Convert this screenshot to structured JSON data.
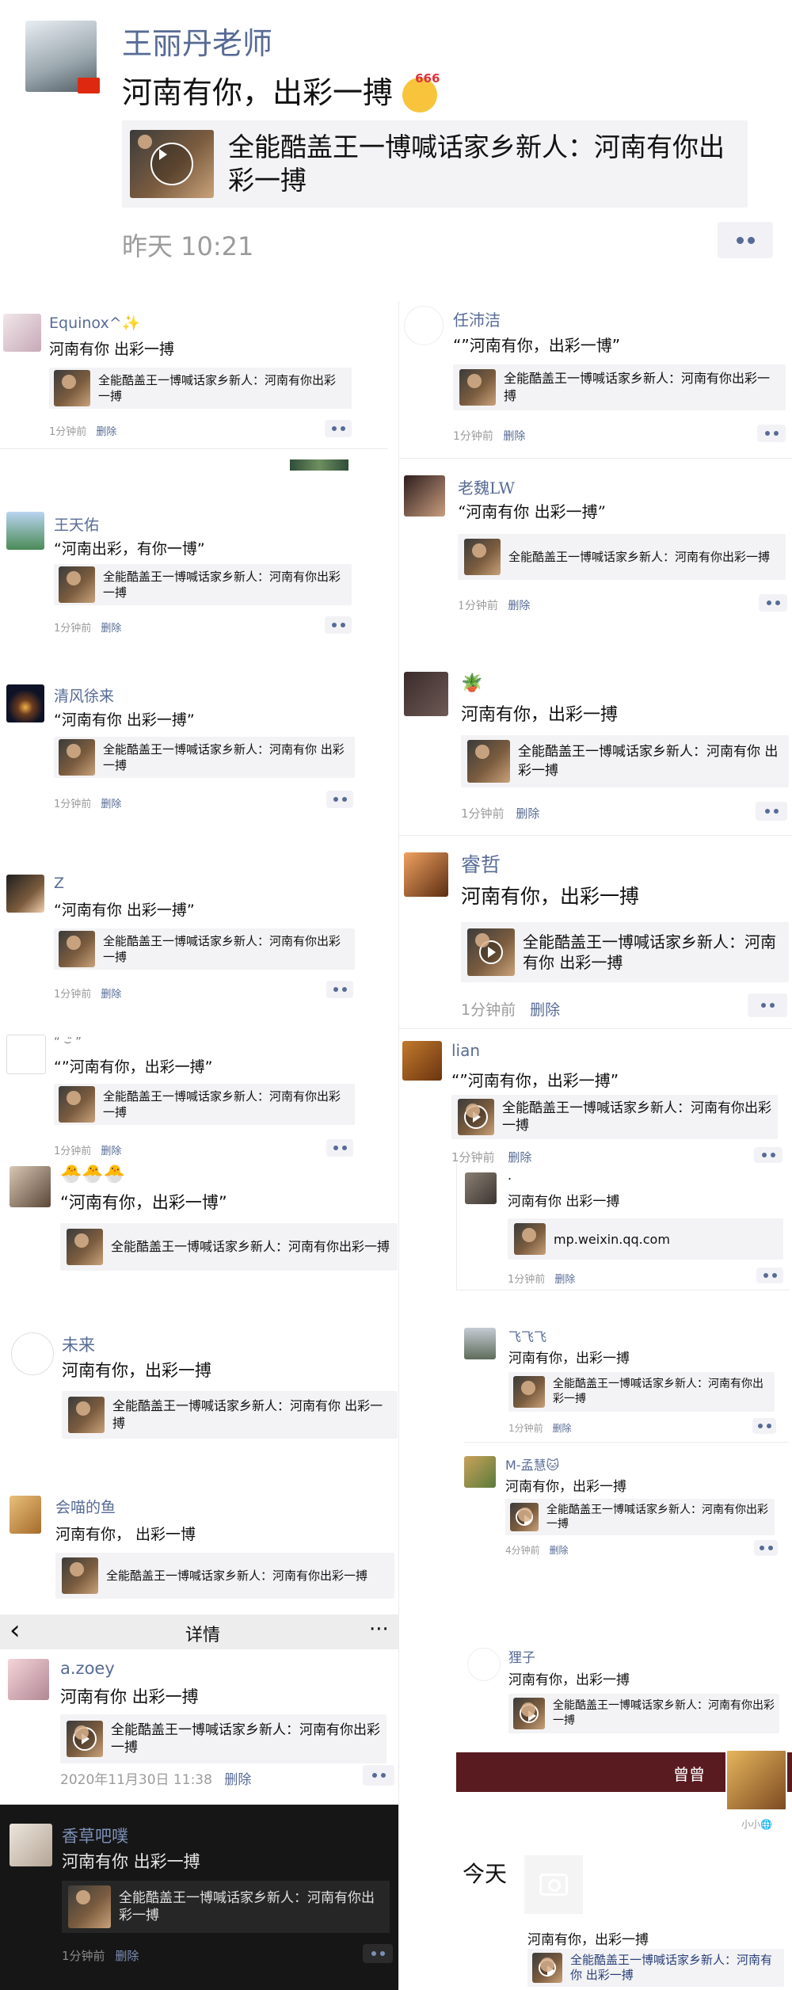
{
  "top": {
    "author": "王丽丹老师",
    "text": "河南有你，出彩一搏",
    "emoji_badge": "666",
    "link": "全能酷盖王一博喊话家乡新人：河南有你出彩一搏",
    "time": "昨天 10:21"
  },
  "left": [
    {
      "name": "Equinox^✨",
      "text": "河南有你 出彩一搏",
      "link": "全能酷盖王一博喊话家乡新人：河南有你出彩一搏",
      "time": "1分钟前",
      "del": "删除"
    },
    {
      "name": "王天佑",
      "text": "“河南出彩，有你一博”",
      "link": "全能酷盖王一博喊话家乡新人：河南有你出彩一搏",
      "time": "1分钟前",
      "del": "删除"
    },
    {
      "name": "清风徐来",
      "text": "“河南有你 出彩一搏”",
      "link": "全能酷盖王一博喊话家乡新人：河南有你 出彩一搏",
      "time": "1分钟前",
      "del": "删除"
    },
    {
      "name": "Z",
      "text": "“河南有你  出彩一搏”",
      "link": "全能酷盖王一博喊话家乡新人：河南有你出彩一搏",
      "time": "1分钟前",
      "del": "删除"
    },
    {
      "name": "“  ⌣̈  ”",
      "text": "“”河南有你，出彩一搏”",
      "link": "全能酷盖王一博喊话家乡新人：河南有你出彩一搏",
      "time": "1分钟前",
      "del": "删除"
    },
    {
      "name": "🐣🐣🐣",
      "text": "“河南有你，出彩一博”",
      "link": "全能酷盖王一博喊话家乡新人：河南有你出彩一搏"
    },
    {
      "name": "未来",
      "text": "河南有你，出彩一搏",
      "link": "全能酷盖王一博喊话家乡新人：河南有你 出彩一搏"
    },
    {
      "name": "会喵的鱼",
      "text": "河南有你， 出彩一博",
      "link": "全能酷盖王一博喊话家乡新人：河南有你出彩一搏"
    }
  ],
  "right": [
    {
      "name": "任沛洁",
      "text": "“”河南有你，出彩一博”",
      "link": "全能酷盖王一博喊话家乡新人：河南有你出彩一搏",
      "time": "1分钟前",
      "del": "删除"
    },
    {
      "name": "老魏LW",
      "text": "“河南有你    出彩一搏”",
      "link": "全能酷盖王一博喊话家乡新人：河南有你出彩一搏",
      "time": "1分钟前",
      "del": "删除"
    },
    {
      "name": "🪴",
      "text": "河南有你，出彩一搏",
      "link": "全能酷盖王一博喊话家乡新人：河南有你 出彩一搏",
      "time": "1分钟前",
      "del": "删除"
    },
    {
      "name": "睿哲",
      "text": "河南有你，出彩一搏",
      "link": "全能酷盖王一博喊话家乡新人：河南有你 出彩一搏",
      "time": "1分钟前",
      "del": "删除"
    },
    {
      "name": "lian",
      "text": "“”河南有你，出彩一搏”",
      "link": "全能酷盖王一博喊话家乡新人：河南有你出彩一搏",
      "time": "1分钟前",
      "del": "删除"
    },
    {
      "name": ".",
      "text": "河南有你 出彩一搏",
      "link": "mp.weixin.qq.com",
      "time": "1分钟前",
      "del": "删除"
    },
    {
      "name": "飞飞飞",
      "text": "河南有你，出彩一搏",
      "link": "全能酷盖王一博喊话家乡新人：河南有你出彩一搏",
      "time": "1分钟前",
      "del": "删除"
    },
    {
      "name": "M-孟慧🐱",
      "text": "河南有你，出彩一搏",
      "link": "全能酷盖王一博喊话家乡新人：河南有你出彩一搏",
      "time": "4分钟前",
      "del": "删除"
    },
    {
      "name": "狸子",
      "text": "河南有你，出彩一搏",
      "link": "全能酷盖王一博喊话家乡新人：河南有你出彩一搏"
    }
  ],
  "detail": {
    "back": "‹",
    "title": "详情",
    "more": "···",
    "post": {
      "name": "a.zoey",
      "text": "河南有你 出彩一搏",
      "link": "全能酷盖王一博喊话家乡新人：河南有你出彩一搏",
      "time": "2020年11月30日 11:38",
      "del": "删除"
    }
  },
  "dark": {
    "name": "香草吧噗",
    "text": "河南有你 出彩一搏",
    "link": "全能酷盖王一博喊话家乡新人：河南有你出彩一搏",
    "time": "1分钟前",
    "del": "删除"
  },
  "banner": {
    "title": "曾曾",
    "caption": "小小🌐"
  },
  "today": {
    "label": "今天",
    "text": "河南有你，出彩一搏",
    "link": "全能酷盖王一博喊话家乡新人：河南有你 出彩一搏"
  }
}
